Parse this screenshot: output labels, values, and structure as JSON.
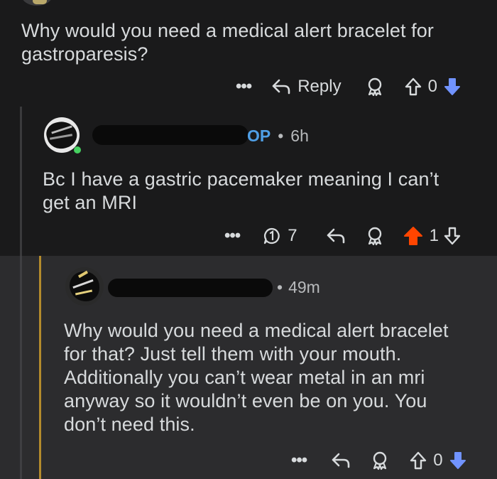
{
  "comment1": {
    "text": "Why would you need a medical alert bracelet for gastroparesis?",
    "line1": "Why would you need a medical alert bracelet for",
    "line2": "gastroparesis?",
    "actions": {
      "more": "•••",
      "reply_label": "Reply",
      "score": "0"
    }
  },
  "comment2": {
    "badge": "OP",
    "separator": "•",
    "age": "6h",
    "line1": "Bc I have a gastric pacemaker meaning I can’t",
    "line2": "get an MRI",
    "actions": {
      "more": "•••",
      "replies": "7",
      "score": "1"
    }
  },
  "comment3": {
    "separator": "•",
    "age": "49m",
    "lines": [
      "Why would you need a medical alert bracelet",
      "for that? Just tell them with your mouth.",
      "Additionally you can’t wear metal in an mri",
      "anyway so it wouldn’t even be on you. You",
      "don’t need this."
    ],
    "actions": {
      "more": "•••",
      "score": "0"
    }
  },
  "colors": {
    "upvoted": "#ff4500",
    "downvoted": "#7193ff",
    "op": "#4f9fe6",
    "thread_highlight": "#b48b2c"
  }
}
